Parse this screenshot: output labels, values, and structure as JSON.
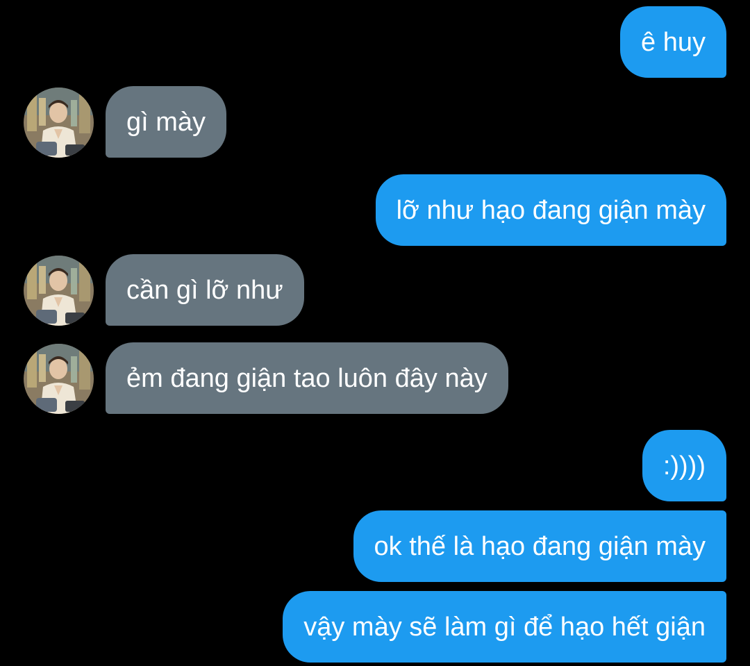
{
  "conversation": {
    "messages": [
      {
        "sender": "me",
        "text": "ê huy"
      },
      {
        "sender": "contact",
        "text": "gì mày"
      },
      {
        "sender": "me",
        "text": "lỡ như hạo đang giận mày"
      },
      {
        "sender": "contact",
        "text": "cần gì lỡ như"
      },
      {
        "sender": "contact",
        "text": "ẻm đang giận tao luôn đây này"
      },
      {
        "sender": "me",
        "text": ":))))"
      },
      {
        "sender": "me",
        "text": "ok thế là hạo đang giận mày"
      },
      {
        "sender": "me",
        "text": "vậy mày sẽ làm gì để hạo hết giận"
      }
    ]
  },
  "colors": {
    "background": "#000000",
    "outgoing_bubble": "#1d9bf0",
    "incoming_bubble": "#66757f",
    "text": "#ffffff"
  },
  "icons": {
    "contact_avatar": "user-photo-avatar"
  }
}
